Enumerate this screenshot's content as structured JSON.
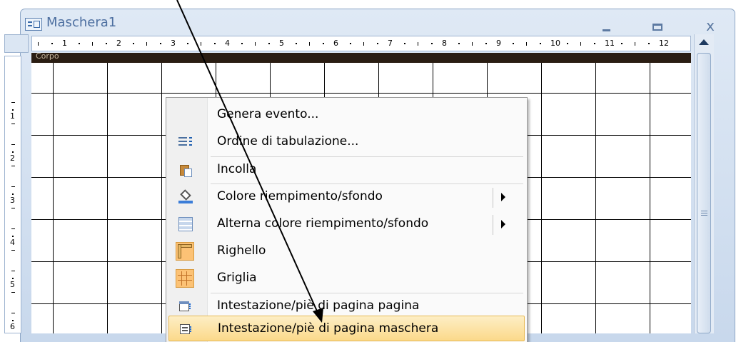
{
  "window": {
    "title": "Maschera1",
    "close_glyph": "x"
  },
  "ruler": {
    "horizontal_numbers": [
      "1",
      "2",
      "3",
      "4",
      "5",
      "6",
      "7",
      "8",
      "9",
      "10",
      "11",
      "12"
    ],
    "vertical_numbers": [
      "1",
      "2",
      "3",
      "4",
      "5",
      "6"
    ]
  },
  "section": {
    "label": "Corpo"
  },
  "context_menu": {
    "items": [
      {
        "label": "Genera evento...",
        "icon": "none"
      },
      {
        "label": "Ordine di tabulazione...",
        "icon": "tab-order-icon"
      },
      {
        "label": "Incolla",
        "icon": "paste-icon"
      },
      {
        "label": "Colore riempimento/sfondo",
        "icon": "fill-color-icon",
        "submenu": true
      },
      {
        "label": "Alterna colore riempimento/sfondo",
        "icon": "alternate-fill-icon",
        "submenu": true
      },
      {
        "label": "Righello",
        "icon": "ruler-icon",
        "checked": true
      },
      {
        "label": "Griglia",
        "icon": "grid-icon",
        "checked": true
      },
      {
        "label": "Intestazione/piè di pagina pagina",
        "icon": "page-header-icon"
      },
      {
        "label": "Intestazione/piè di pagina maschera",
        "icon": "form-header-icon",
        "highlighted": true
      }
    ]
  },
  "colors": {
    "highlight": "#fbd98a",
    "checked_icon_bg": "#fcc275",
    "title_text": "#4d6fa0"
  }
}
